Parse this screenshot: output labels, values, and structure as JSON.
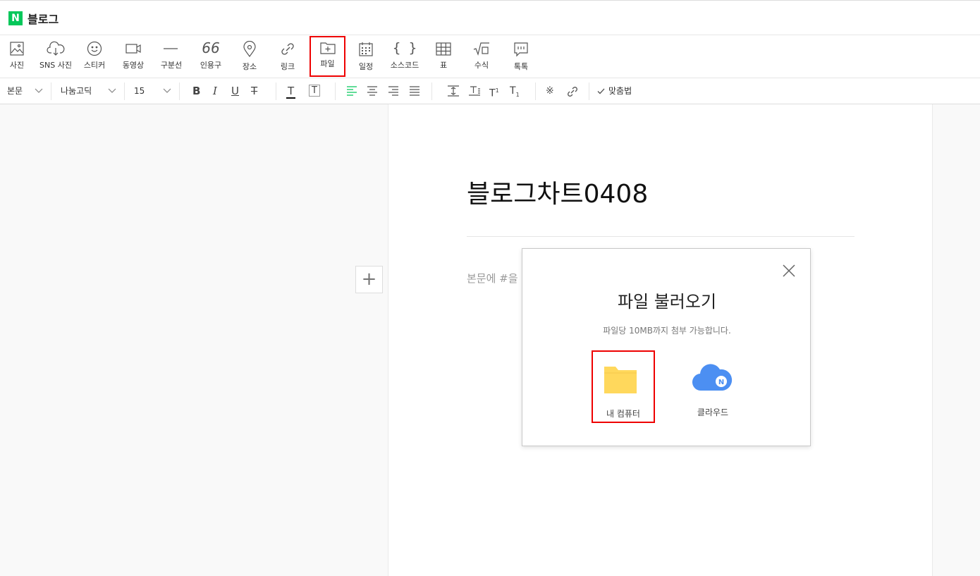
{
  "app": {
    "logo_letter": "N",
    "title": "블로그"
  },
  "toolbar": {
    "items": [
      {
        "label": "사진",
        "icon": "image-icon"
      },
      {
        "label": "SNS 사진",
        "icon": "cloud-download-icon"
      },
      {
        "label": "스티커",
        "icon": "smile-icon"
      },
      {
        "label": "동영상",
        "icon": "video-icon"
      },
      {
        "label": "구분선",
        "icon": "divider-icon"
      },
      {
        "label": "인용구",
        "icon": "quote-icon"
      },
      {
        "label": "장소",
        "icon": "location-pin-icon"
      },
      {
        "label": "링크",
        "icon": "link-icon"
      },
      {
        "label": "파일",
        "icon": "file-folder-icon"
      },
      {
        "label": "일정",
        "icon": "calendar-icon"
      },
      {
        "label": "소스코드",
        "icon": "code-braces-icon"
      },
      {
        "label": "표",
        "icon": "table-icon"
      },
      {
        "label": "수식",
        "icon": "formula-icon"
      },
      {
        "label": "톡톡",
        "icon": "chat-icon"
      }
    ],
    "quote_glyph": "66"
  },
  "format": {
    "style": "본문",
    "font": "나눔고딕",
    "size": "15",
    "spell_check": "맞춤법"
  },
  "editor": {
    "title": "블로그차트0408",
    "body_placeholder": "본문에 #을",
    "plus_glyph": "+"
  },
  "modal": {
    "title": "파일 불러오기",
    "subtitle": "파일당 10MB까지 첨부 가능합니다.",
    "options": [
      {
        "label": "내 컴퓨터",
        "icon": "folder-icon"
      },
      {
        "label": "클라우드",
        "icon": "cloud-icon",
        "badge": "N"
      }
    ]
  },
  "colors": {
    "brand": "#03c75a",
    "highlight": "#e00000",
    "folder": "#ffd85c",
    "cloud": "#4c8ff2",
    "align_active": "#03c75a"
  }
}
